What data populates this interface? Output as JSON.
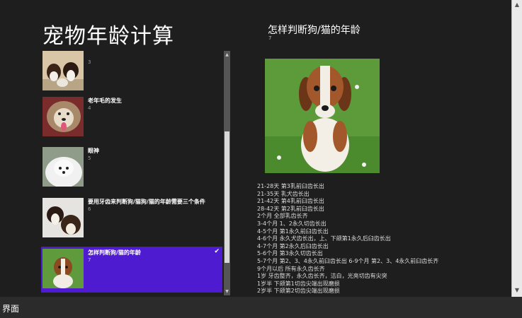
{
  "app": {
    "title": "宠物年龄计算"
  },
  "list": {
    "items": [
      {
        "title": "",
        "num": "3"
      },
      {
        "title": "老年毛的发生",
        "num": "4"
      },
      {
        "title": "眼神",
        "num": "5"
      },
      {
        "title": "要用牙齿来判断狗/猫狗/猫的年龄需要三个条件",
        "num": "6"
      },
      {
        "title": "怎样判断狗/猫的年龄",
        "num": "7",
        "selected": true
      }
    ]
  },
  "detail": {
    "title": "怎样判断狗/猫的年龄",
    "num": "7",
    "lines": [
      "21-28天 第3乳前臼齿长出",
      "21-35天 乳犬齿长出",
      "21-42天 第4乳前臼齿长出",
      "28-42天 第2乳前臼齿长出",
      "2个月 全部乳齿长齐",
      "3-4个月 1、2永久切齿长出",
      "4-5个月 第1永久前臼齿长出",
      "4-6个月 永久犬齿长出，上、下颌第1永久后臼齿长出",
      "4-7个月 第2永久后臼齿长出",
      "5-6个月 第3永久切齿长出",
      "5-7个月 第2、3、4永久前臼齿长出 6-9个月 第2、3、4永久前臼齿长齐",
      "9个月以后 所有永久齿长齐",
      "1岁 牙齿整齐，永久齿长齐，洁白，光亮切齿有尖突",
      "1岁半 下颌第1切齿尖端出现磨损",
      "2岁半 下颌第2切齿尖端出现磨损"
    ]
  },
  "taskbar": {
    "label": "界面"
  },
  "colors": {
    "background": "#1e1e1e",
    "accent": "#4f1bd1"
  }
}
